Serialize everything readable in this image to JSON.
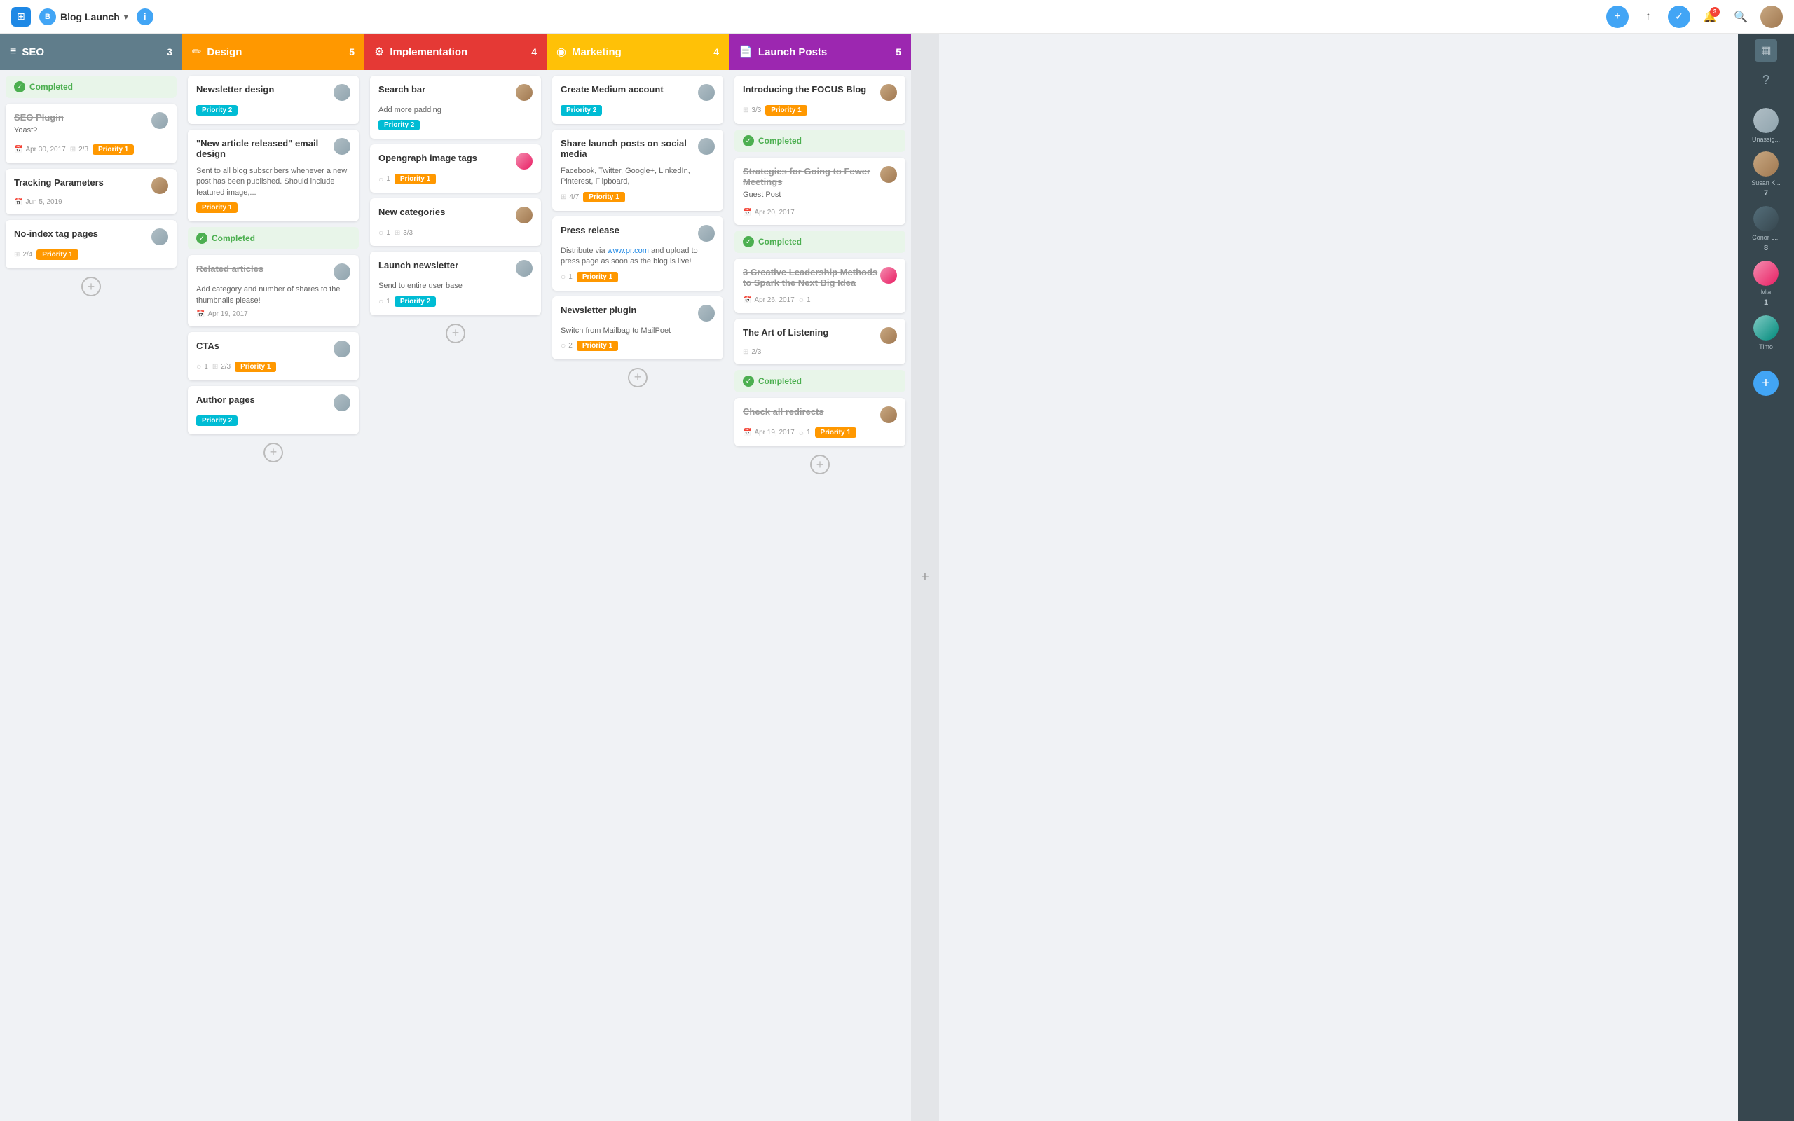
{
  "nav": {
    "home_icon": "⊞",
    "project_name": "Blog Launch",
    "info_label": "i",
    "add_icon": "+",
    "upload_icon": "↑",
    "check_icon": "✓",
    "bell_icon": "🔔",
    "bell_badge": "3",
    "search_icon": "🔍"
  },
  "columns": [
    {
      "id": "seo",
      "icon": "≡",
      "title": "SEO",
      "count": "3",
      "color": "col-seo",
      "cards": [
        {
          "id": "completed-seo",
          "type": "completed-section",
          "label": "Completed"
        },
        {
          "id": "seo-plugin",
          "title": "SEO Plugin",
          "subtitle": "Yoast?",
          "strikethrough": true,
          "date": "Apr 30, 2017",
          "subtasks": "2/3",
          "badge": "Priority 1",
          "badge_class": "badge-priority1",
          "avatar_class": "avatar-gray"
        },
        {
          "id": "tracking",
          "title": "Tracking Parameters",
          "strikethrough": false,
          "date": "Jun 5, 2019",
          "avatar_class": "avatar-brown"
        },
        {
          "id": "no-index",
          "title": "No-index tag pages",
          "strikethrough": false,
          "subtasks": "2/4",
          "badge": "Priority 1",
          "badge_class": "badge-priority1",
          "avatar_class": "avatar-gray"
        }
      ]
    },
    {
      "id": "design",
      "icon": "✏",
      "title": "Design",
      "count": "5",
      "color": "col-design",
      "cards": [
        {
          "id": "newsletter-design",
          "title": "Newsletter design",
          "badge": "Priority 2",
          "badge_class": "badge-priority2",
          "avatar_class": "avatar-gray"
        },
        {
          "id": "new-article-email",
          "title": "\"New article released\" email design",
          "desc": "Sent to all blog subscribers whenever a new post has been published. Should include featured image,...",
          "badge": "Priority 1",
          "badge_class": "badge-priority1",
          "avatar_class": "avatar-gray"
        },
        {
          "id": "completed-design",
          "type": "completed-section",
          "label": "Completed"
        },
        {
          "id": "related-articles",
          "title": "Related articles",
          "strikethrough": true,
          "desc": "Add category and number of shares to the thumbnails please!",
          "date": "Apr 19, 2017",
          "avatar_class": "avatar-gray"
        },
        {
          "id": "ctas",
          "title": "CTAs",
          "comments": "1",
          "subtasks": "2/3",
          "badge": "Priority 1",
          "badge_class": "badge-priority1",
          "avatar_class": "avatar-gray"
        },
        {
          "id": "author-pages",
          "title": "Author pages",
          "badge": "Priority 2",
          "badge_class": "badge-priority2",
          "avatar_class": "avatar-gray"
        }
      ]
    },
    {
      "id": "implementation",
      "icon": "⚙",
      "title": "Implementation",
      "count": "4",
      "color": "col-impl",
      "cards": [
        {
          "id": "search-bar",
          "title": "Search bar",
          "desc": "Add more padding",
          "badge": "Priority 2",
          "badge_class": "badge-priority2",
          "avatar_class": "avatar-brown"
        },
        {
          "id": "opengraph",
          "title": "Opengraph image tags",
          "comments": "1",
          "badge": "Priority 1",
          "badge_class": "badge-priority1",
          "avatar_class": "avatar-pink"
        },
        {
          "id": "new-categories",
          "title": "New categories",
          "comments": "1",
          "subtasks": "3/3",
          "avatar_class": "avatar-brown"
        },
        {
          "id": "launch-newsletter",
          "title": "Launch newsletter",
          "desc": "Send to entire user base",
          "comments": "1",
          "badge": "Priority 2",
          "badge_class": "badge-priority2",
          "avatar_class": "avatar-gray"
        }
      ]
    },
    {
      "id": "marketing",
      "icon": "◉",
      "title": "Marketing",
      "count": "4",
      "color": "col-marketing",
      "cards": [
        {
          "id": "create-medium",
          "title": "Create Medium account",
          "badge": "Priority 2",
          "badge_class": "badge-priority2",
          "avatar_class": "avatar-gray"
        },
        {
          "id": "share-launch",
          "title": "Share launch posts on social media",
          "desc": "Facebook, Twitter, Google+, LinkedIn, Pinterest, Flipboard,",
          "subtasks": "4/7",
          "badge": "Priority 1",
          "badge_class": "badge-priority1",
          "avatar_class": "avatar-gray"
        },
        {
          "id": "press-release",
          "title": "Press release",
          "desc_link": "www.pr.com",
          "desc_rest": " and upload to press page as soon as the blog is live!",
          "comments": "1",
          "badge": "Priority 1",
          "badge_class": "badge-priority1",
          "avatar_class": "avatar-gray"
        },
        {
          "id": "newsletter-plugin",
          "title": "Newsletter plugin",
          "desc": "Switch from Mailbag to MailPoet",
          "comments": "2",
          "badge": "Priority 1",
          "badge_class": "badge-priority1",
          "avatar_class": "avatar-gray"
        }
      ]
    },
    {
      "id": "launch-posts",
      "icon": "📄",
      "title": "Launch Posts",
      "count": "5",
      "color": "col-launch",
      "cards": [
        {
          "id": "introducing-focus",
          "title": "Introducing the FOCUS Blog",
          "subtasks": "3/3",
          "badge": "Priority 1",
          "badge_class": "badge-priority1",
          "avatar_class": "avatar-brown"
        },
        {
          "id": "completed-launch1",
          "type": "completed-section",
          "label": "Completed"
        },
        {
          "id": "strategies-meetings",
          "title": "Strategies for Going to Fewer Meetings",
          "subtitle": "Guest Post",
          "strikethrough": true,
          "date": "Apr 20, 2017",
          "avatar_class": "avatar-brown"
        },
        {
          "id": "completed-launch2",
          "type": "completed-section",
          "label": "Completed"
        },
        {
          "id": "creative-leadership",
          "title": "3 Creative Leadership Methods to Spark the Next Big Idea",
          "strikethrough": true,
          "date": "Apr 26, 2017",
          "comments": "1",
          "avatar_class": "avatar-pink"
        },
        {
          "id": "art-of-listening",
          "title": "The Art of Listening",
          "subtasks": "2/3",
          "avatar_class": "avatar-brown"
        },
        {
          "id": "completed-launch3",
          "type": "completed-section",
          "label": "Completed"
        },
        {
          "id": "check-redirects",
          "title": "Check all redirects",
          "strikethrough": true,
          "date": "Apr 19, 2017",
          "comments": "1",
          "badge": "Priority 1",
          "badge_class": "badge-priority1",
          "avatar_class": "avatar-brown"
        }
      ]
    }
  ],
  "sidebar": {
    "question_icon": "?",
    "users": [
      {
        "label": "Unassig...",
        "count": "",
        "avatar_class": "avatar-gray"
      },
      {
        "label": "Susan K...",
        "count": "7",
        "avatar_class": "avatar-brown"
      },
      {
        "label": "Conor L...",
        "count": "8",
        "avatar_class": "avatar-dark"
      },
      {
        "label": "Mia",
        "count": "1",
        "avatar_class": "avatar-pink"
      },
      {
        "label": "Timo",
        "count": "",
        "avatar_class": "avatar-gray"
      }
    ],
    "add_label": "+"
  }
}
